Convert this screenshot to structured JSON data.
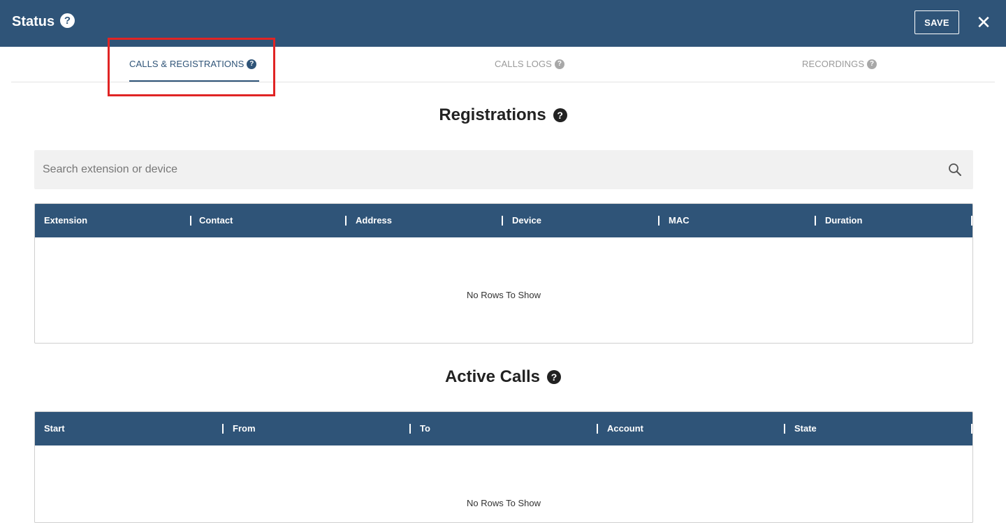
{
  "header": {
    "title": "Status",
    "help": "?",
    "save_label": "SAVE",
    "close": "✕"
  },
  "tabs": [
    {
      "label": "CALLS & REGISTRATIONS",
      "active": true
    },
    {
      "label": "CALLS LOGS",
      "active": false
    },
    {
      "label": "RECORDINGS",
      "active": false
    }
  ],
  "registrations": {
    "title": "Registrations",
    "search_placeholder": "Search extension or device",
    "columns": [
      "Extension",
      "Contact",
      "Address",
      "Device",
      "MAC",
      "Duration"
    ],
    "empty_text": "No Rows To Show"
  },
  "active_calls": {
    "title": "Active Calls",
    "columns": [
      "Start",
      "From",
      "To",
      "Account",
      "State"
    ],
    "empty_text": "No Rows To Show"
  },
  "colors": {
    "primary": "#2f5478",
    "highlight": "#e02424"
  },
  "icons": {
    "help": "question-circle-icon",
    "search": "magnifier-icon",
    "close": "x-icon"
  }
}
